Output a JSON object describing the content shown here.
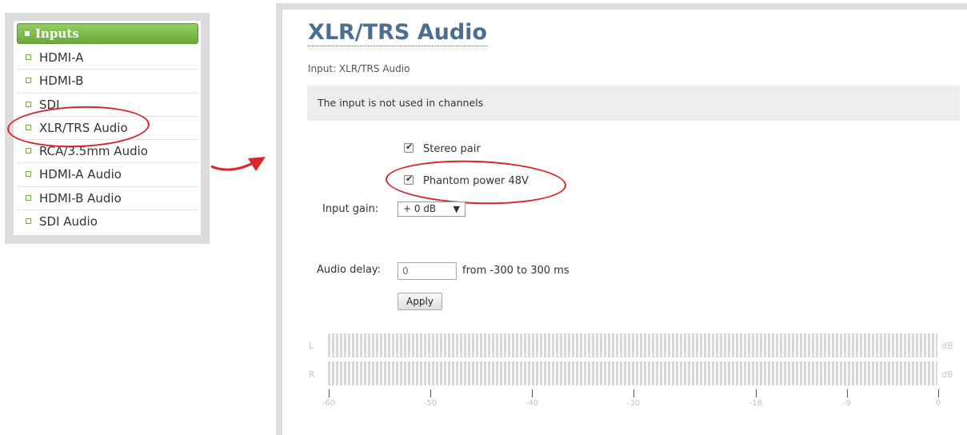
{
  "sidebar": {
    "header": "Inputs",
    "items": [
      "HDMI-A",
      "HDMI-B",
      "SDI",
      "XLR/TRS Audio",
      "RCA/3.5mm Audio",
      "HDMI-A Audio",
      "HDMI-B Audio",
      "SDI Audio"
    ]
  },
  "main": {
    "title": "XLR/TRS Audio",
    "subtitle": "Input: XLR/TRS Audio",
    "notice": "The input is not used in channels",
    "stereo_pair_label": "Stereo pair",
    "phantom_power_label": "Phantom power 48V",
    "input_gain_label": "Input gain:",
    "input_gain_value": "+ 0 dB",
    "input_gain_arrow": "▼",
    "audio_delay_label": "Audio delay:",
    "audio_delay_value": "0",
    "audio_delay_range": "from -300 to 300 ms",
    "apply_label": "Apply"
  },
  "meter": {
    "left_channel": "L",
    "right_channel": "R",
    "unit": "dB",
    "scale": [
      "-60",
      "-50",
      "-40",
      "-30",
      "-18",
      "-9",
      "0"
    ]
  },
  "colors": {
    "annotation": "#d9252b",
    "header_green": "#6aa83a",
    "title_blue": "#4d6d91"
  }
}
